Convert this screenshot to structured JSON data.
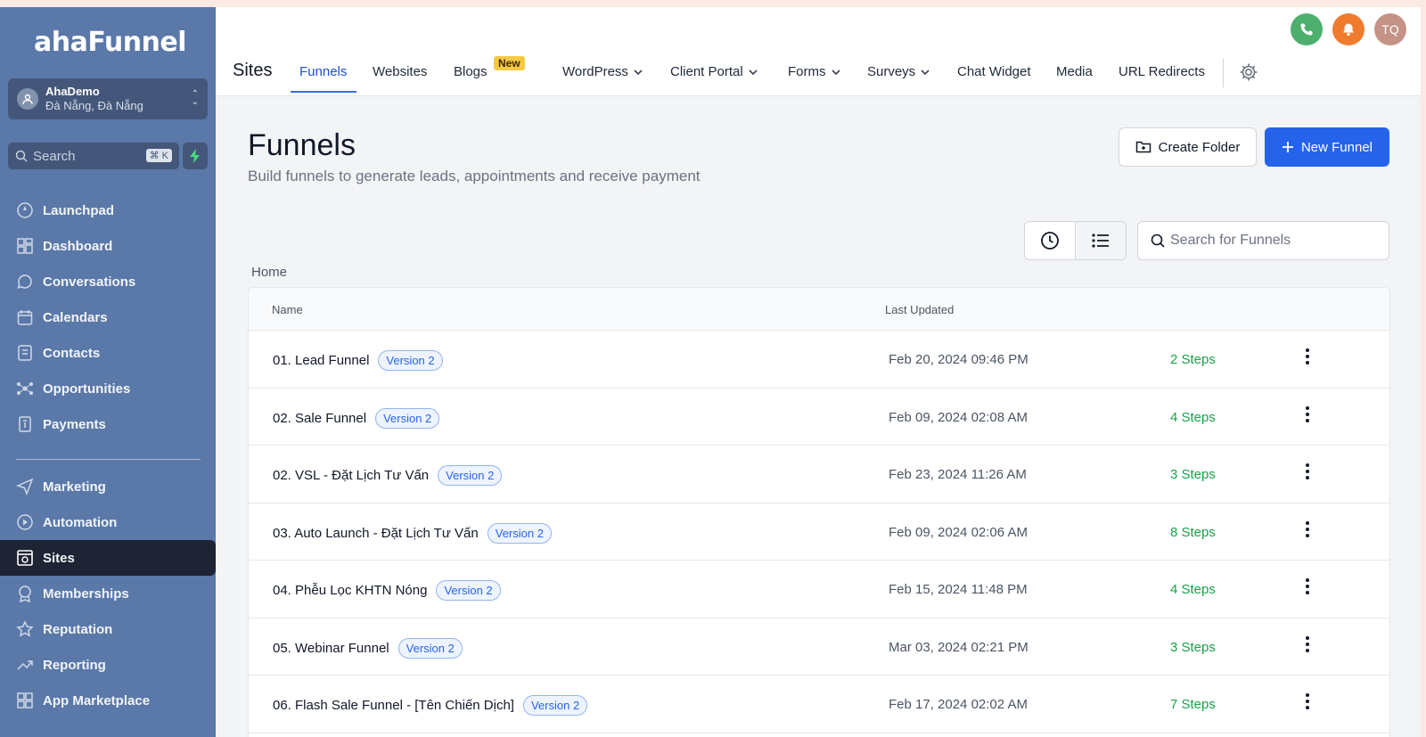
{
  "sidebar": {
    "logo": "ahaFunnel",
    "account": {
      "name": "AhaDemo",
      "location": "Đà Nẵng, Đà Nẵng"
    },
    "search": {
      "placeholder": "Search",
      "shortcut": "⌘ K"
    },
    "items_top": [
      {
        "label": "Launchpad",
        "icon": "rocket-icon"
      },
      {
        "label": "Dashboard",
        "icon": "grid-icon"
      },
      {
        "label": "Conversations",
        "icon": "chat-icon"
      },
      {
        "label": "Calendars",
        "icon": "calendar-icon"
      },
      {
        "label": "Contacts",
        "icon": "contacts-icon"
      },
      {
        "label": "Opportunities",
        "icon": "opportunities-icon"
      },
      {
        "label": "Payments",
        "icon": "payments-icon"
      }
    ],
    "items_bottom": [
      {
        "label": "Marketing",
        "icon": "send-icon"
      },
      {
        "label": "Automation",
        "icon": "automation-icon"
      },
      {
        "label": "Sites",
        "icon": "sites-icon",
        "active": true
      },
      {
        "label": "Memberships",
        "icon": "memberships-icon"
      },
      {
        "label": "Reputation",
        "icon": "star-icon"
      },
      {
        "label": "Reporting",
        "icon": "trend-icon"
      },
      {
        "label": "App Marketplace",
        "icon": "apps-icon"
      }
    ]
  },
  "topbar": {
    "title": "Sites",
    "tabs": [
      {
        "label": "Funnels",
        "active": true
      },
      {
        "label": "Websites"
      },
      {
        "label": "Blogs"
      },
      {
        "label": "WordPress",
        "dropdown": true
      },
      {
        "label": "Client Portal",
        "dropdown": true
      },
      {
        "label": "Forms",
        "dropdown": true
      },
      {
        "label": "Surveys",
        "dropdown": true
      },
      {
        "label": "Chat Widget"
      },
      {
        "label": "Media"
      },
      {
        "label": "URL Redirects"
      }
    ],
    "new_badge": "New",
    "user_initials": "TQ",
    "colors": {
      "phone": "#4caf6e",
      "bell": "#f07b2d",
      "avatar": "#c49385"
    }
  },
  "main": {
    "title": "Funnels",
    "subtitle": "Build funnels to generate leads, appointments and receive payment",
    "create_folder": "Create Folder",
    "new_funnel": "New Funnel",
    "search_placeholder": "Search for Funnels",
    "breadcrumb": "Home",
    "columns": {
      "name": "Name",
      "updated": "Last Updated"
    },
    "rows": [
      {
        "name": "01. Lead Funnel",
        "version": "Version 2",
        "updated": "Feb 20, 2024 09:46 PM",
        "steps": "2 Steps"
      },
      {
        "name": "02. Sale Funnel",
        "version": "Version 2",
        "updated": "Feb 09, 2024 02:08 AM",
        "steps": "4 Steps"
      },
      {
        "name": "02. VSL - Đặt Lịch Tư Vấn",
        "version": "Version 2",
        "updated": "Feb 23, 2024 11:26 AM",
        "steps": "3 Steps"
      },
      {
        "name": "03. Auto Launch - Đặt Lịch Tư Vấn",
        "version": "Version 2",
        "updated": "Feb 09, 2024 02:06 AM",
        "steps": "8 Steps"
      },
      {
        "name": "04. Phễu Lọc KHTN Nóng",
        "version": "Version 2",
        "updated": "Feb 15, 2024 11:48 PM",
        "steps": "4 Steps"
      },
      {
        "name": "05. Webinar Funnel",
        "version": "Version 2",
        "updated": "Mar 03, 2024 02:21 PM",
        "steps": "3 Steps"
      },
      {
        "name": "06. Flash Sale Funnel - [Tên Chiến Dịch]",
        "version": "Version 2",
        "updated": "Feb 17, 2024 02:02 AM",
        "steps": "7 Steps"
      }
    ]
  }
}
